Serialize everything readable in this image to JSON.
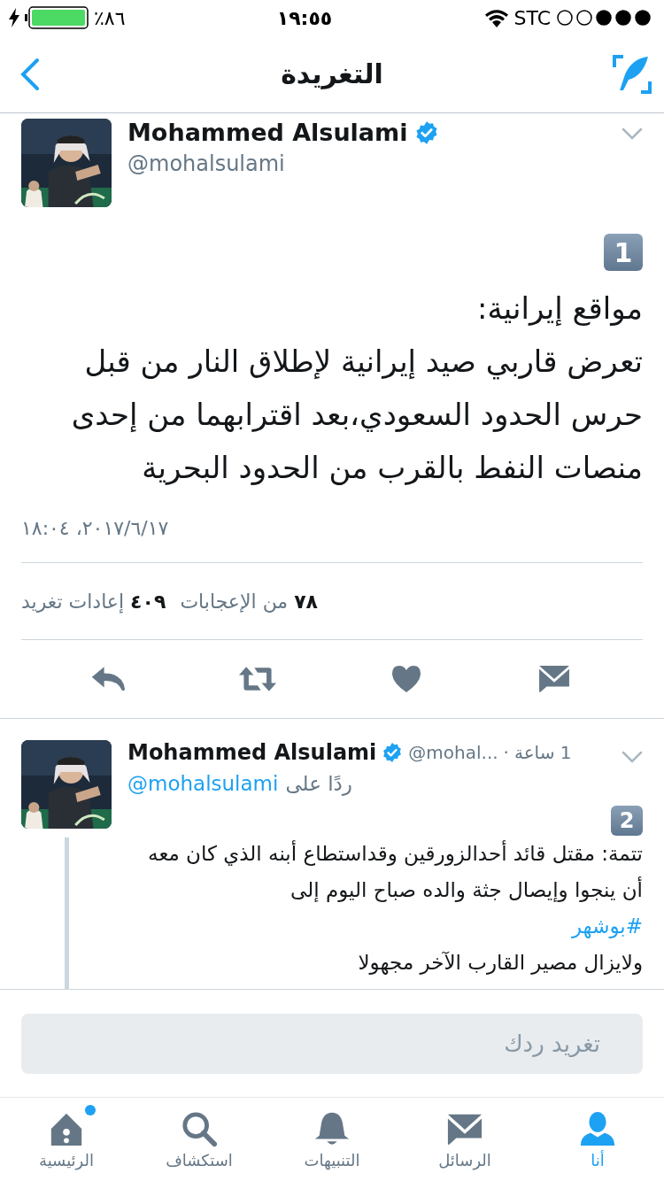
{
  "status_bar": {
    "battery": "٪٨٦",
    "time": "١٩:٥٥",
    "carrier": "STC"
  },
  "nav": {
    "title": "التغريدة"
  },
  "main_tweet": {
    "name": "Mohammed Alsulami",
    "verified": true,
    "handle": "@mohalsulami",
    "badge": "1",
    "paragraphs": [
      "مواقع إيرانية:",
      "تعرض قاربي صيد إيرانية لإطلاق النار من قبل حرس الحدود السعودي،بعد اقترابهما من إحدى منصات النفط بالقرب من الحدود البحرية"
    ],
    "date": "٢٠١٧/٦/١٧، ١٨:٠٤",
    "stats": [
      {
        "count": "٧٨",
        "label": "من الإعجابات"
      },
      {
        "count": "٤٠٩",
        "label": "إعادات تغريد"
      }
    ],
    "actions": [
      {
        "kind": "reply"
      },
      {
        "kind": "retweet"
      },
      {
        "kind": "like"
      },
      {
        "kind": "message"
      }
    ]
  },
  "reply_tweet": {
    "name": "Mohammed Alsulami",
    "verified": true,
    "handle": "@mohal...",
    "separator": "·",
    "time": "1 ساعة",
    "reply_label": "ردًا على",
    "reply_to": "@mohalsulami",
    "badge": "2",
    "paragraphs": [
      {
        "kind": "text",
        "text": "تتمة: مقتل قائد أحدالزورقين وقداستطاع أبنه الذي كان معه أن ينجوا وإيصال جثة والده صباح اليوم إلى"
      },
      {
        "kind": "hashtag",
        "text": "#بوشهر"
      },
      {
        "kind": "text",
        "text": "ولايزال مصير القارب الآخر مجهولا"
      }
    ]
  },
  "composer": {
    "placeholder": "تغريد ردك"
  },
  "tab_bar": [
    {
      "kind": "me",
      "label": "أنا",
      "selected": true,
      "unread": false
    },
    {
      "kind": "messages",
      "label": "الرسائل",
      "selected": false,
      "unread": false
    },
    {
      "kind": "notifications",
      "label": "التنبيهات",
      "selected": false,
      "unread": false
    },
    {
      "kind": "explore",
      "label": "استكشاف",
      "selected": false,
      "unread": false
    },
    {
      "kind": "home",
      "label": "الرئيسية",
      "selected": false,
      "unread": true
    }
  ]
}
